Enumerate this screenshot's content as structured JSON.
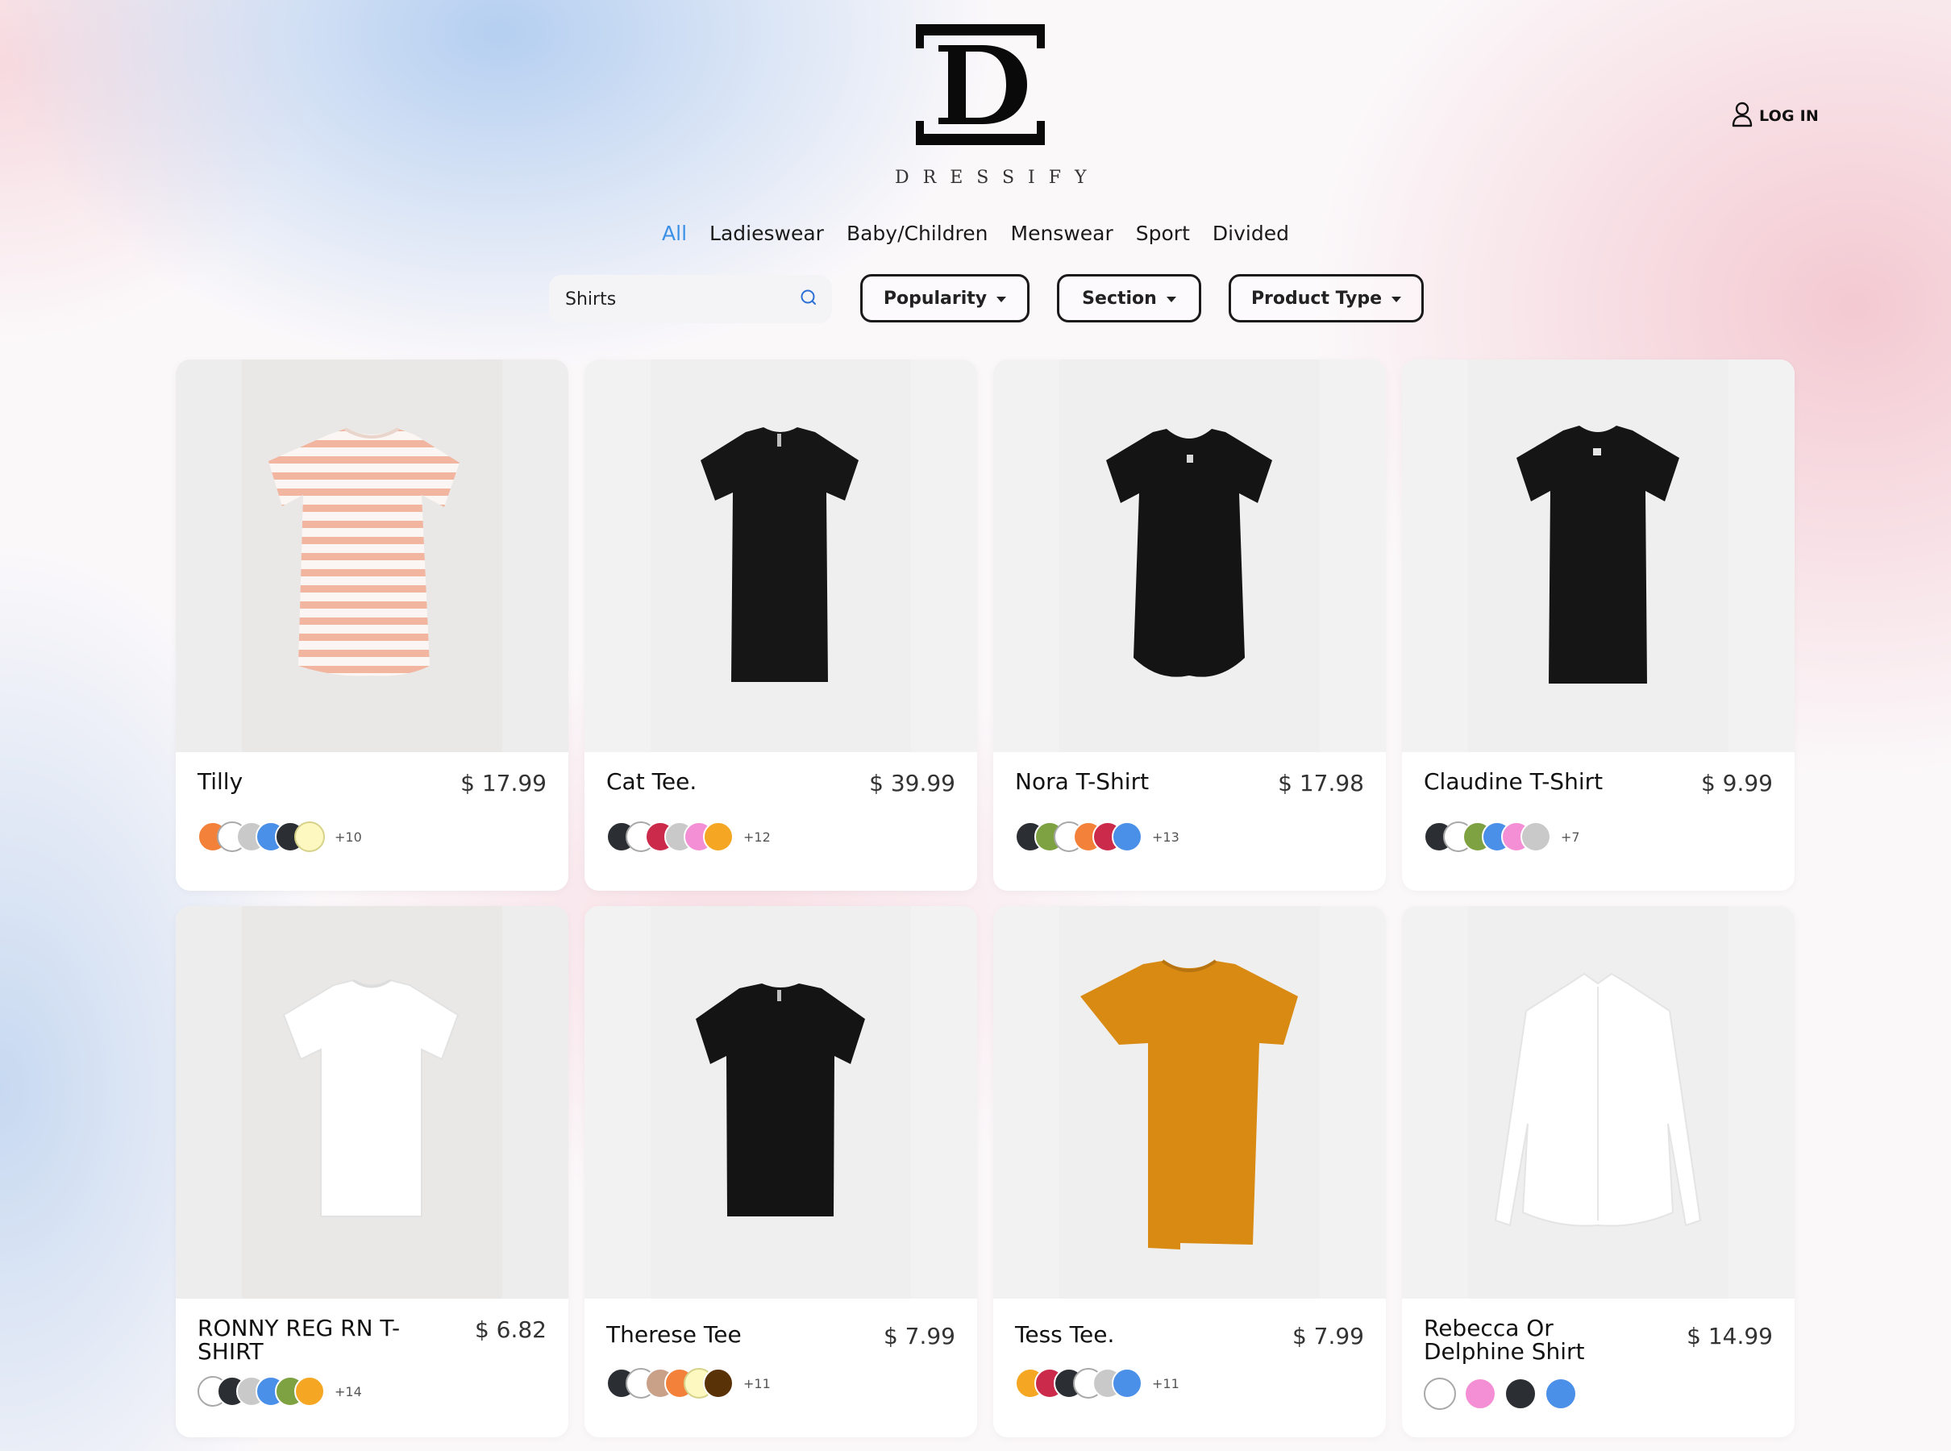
{
  "brand": {
    "name": "DRESSIFY",
    "monogram": "D"
  },
  "header": {
    "login_label": "LOG IN",
    "login_icon": "user-icon"
  },
  "nav": {
    "items": [
      "All",
      "Ladieswear",
      "Baby/Children",
      "Menswear",
      "Sport",
      "Divided"
    ],
    "active": "All",
    "active_color": "#3a8fe6"
  },
  "filters": {
    "search_value": "Shirts",
    "search_icon": "search-icon",
    "popularity_label": "Popularity",
    "section_label": "Section",
    "product_type_label": "Product Type"
  },
  "products": [
    {
      "name": "Tilly",
      "price": "$ 17.99",
      "garment": "striped-tee",
      "swatches": [
        "#f4813a",
        "#ffffff",
        "#c9c9c9",
        "#4a8fe8",
        "#2b2f33",
        "#fdf7c0"
      ],
      "more": "+10"
    },
    {
      "name": "Cat Tee.",
      "price": "$ 39.99",
      "garment": "black-tee",
      "swatches": [
        "#2b2f33",
        "#ffffff",
        "#cc2a4a",
        "#c9c9c9",
        "#f48fd6",
        "#f5a623"
      ],
      "more": "+12"
    },
    {
      "name": "Nora T-Shirt",
      "price": "$ 17.98",
      "garment": "black-scoop-tee",
      "swatches": [
        "#2b2f33",
        "#7ea141",
        "#ffffff",
        "#f4813a",
        "#cc2a4a",
        "#4a8fe8"
      ],
      "more": "+13"
    },
    {
      "name": "Claudine T-Shirt",
      "price": "$ 9.99",
      "garment": "black-tee",
      "swatches": [
        "#2b2f33",
        "#ffffff",
        "#7ea141",
        "#4a8fe8",
        "#f48fd6",
        "#c9c9c9"
      ],
      "more": "+7"
    },
    {
      "name": "RONNY REG RN T-SHIRT",
      "price": "$ 6.82",
      "garment": "white-tee",
      "swatches": [
        "#ffffff",
        "#2b2f33",
        "#c9c9c9",
        "#4a8fe8",
        "#7ea141",
        "#f5a623"
      ],
      "more": "+14"
    },
    {
      "name": "Therese Tee",
      "price": "$ 7.99",
      "garment": "black-boxy-tee",
      "swatches": [
        "#2b2f33",
        "#ffffff",
        "#c9a088",
        "#f4813a",
        "#fdf7c0",
        "#5a3208"
      ],
      "more": "+11"
    },
    {
      "name": "Tess Tee.",
      "price": "$ 7.99",
      "garment": "mustard-tee",
      "swatches": [
        "#f5a623",
        "#cc2a4a",
        "#2b2f33",
        "#ffffff",
        "#c9c9c9",
        "#4a8fe8"
      ],
      "more": "+11"
    },
    {
      "name": "Rebecca Or Delphine Shirt",
      "price": "$ 14.99",
      "garment": "white-shirt",
      "swatches": [
        "#ffffff",
        "#f48fd6",
        "#2b2f33",
        "#4a8fe8"
      ],
      "more": ""
    }
  ]
}
